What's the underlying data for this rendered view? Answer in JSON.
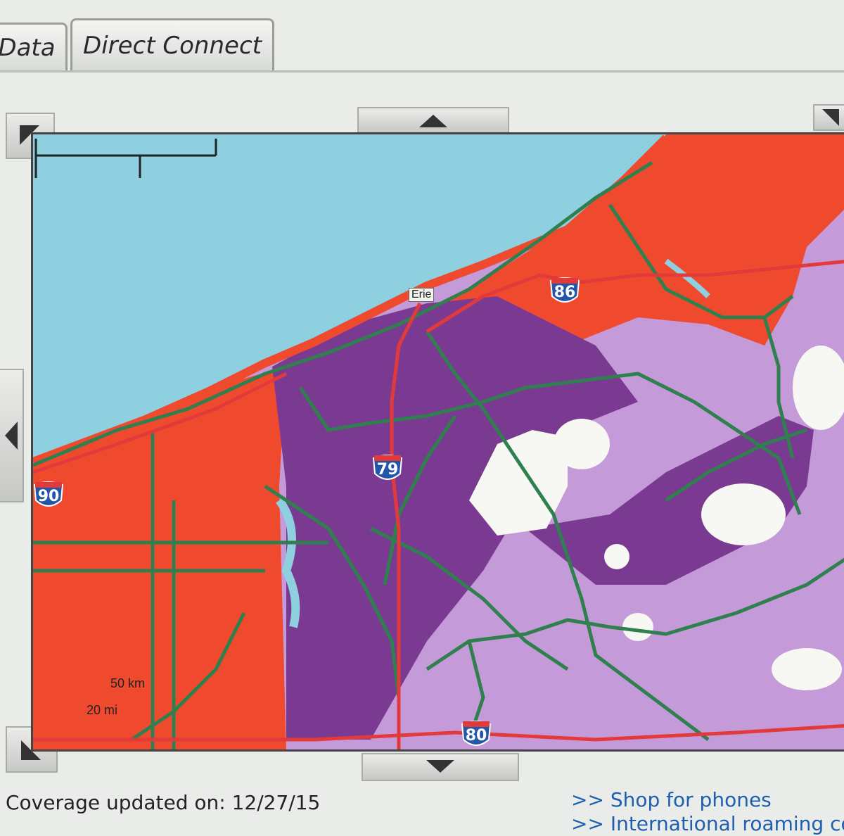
{
  "tabs": [
    {
      "label": "Data"
    },
    {
      "label": "Direct Connect"
    }
  ],
  "map": {
    "city_label": "Erie",
    "interstates": [
      "79",
      "86",
      "90",
      "80"
    ],
    "scale": {
      "km": "50 km",
      "mi": "20 mi"
    },
    "colors": {
      "water": "#8ecfe0",
      "coverage_red": "#f04a2e",
      "coverage_purple": "#7b3a92",
      "coverage_light_purple": "#c49bd8",
      "no_coverage": "#f7f7f4",
      "roads": "#2f7f4f",
      "interstate": "#e23a3a",
      "shield": "#2356a8"
    }
  },
  "footer": {
    "coverage_text": "Coverage updated on: 12/27/15",
    "links": [
      ">> Shop for phones",
      ">> International roaming cove"
    ]
  }
}
